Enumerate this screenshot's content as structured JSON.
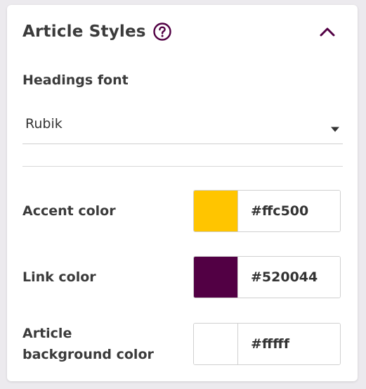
{
  "panel": {
    "title": "Article Styles"
  },
  "icons": {
    "help": "help-circle-icon",
    "collapse": "chevron-up-icon",
    "dropdown": "caret-down-icon"
  },
  "headings_font": {
    "label": "Headings font",
    "value": "Rubik"
  },
  "accent_color": {
    "label": "Accent color",
    "hex": "#ffc500"
  },
  "link_color": {
    "label": "Link color",
    "hex": "#520044"
  },
  "article_background_color": {
    "label_line1": "Article",
    "label_line2": "background color",
    "hex": "#ffffff",
    "display_value": "#fffff"
  },
  "theme": {
    "icon_color": "#520044"
  }
}
